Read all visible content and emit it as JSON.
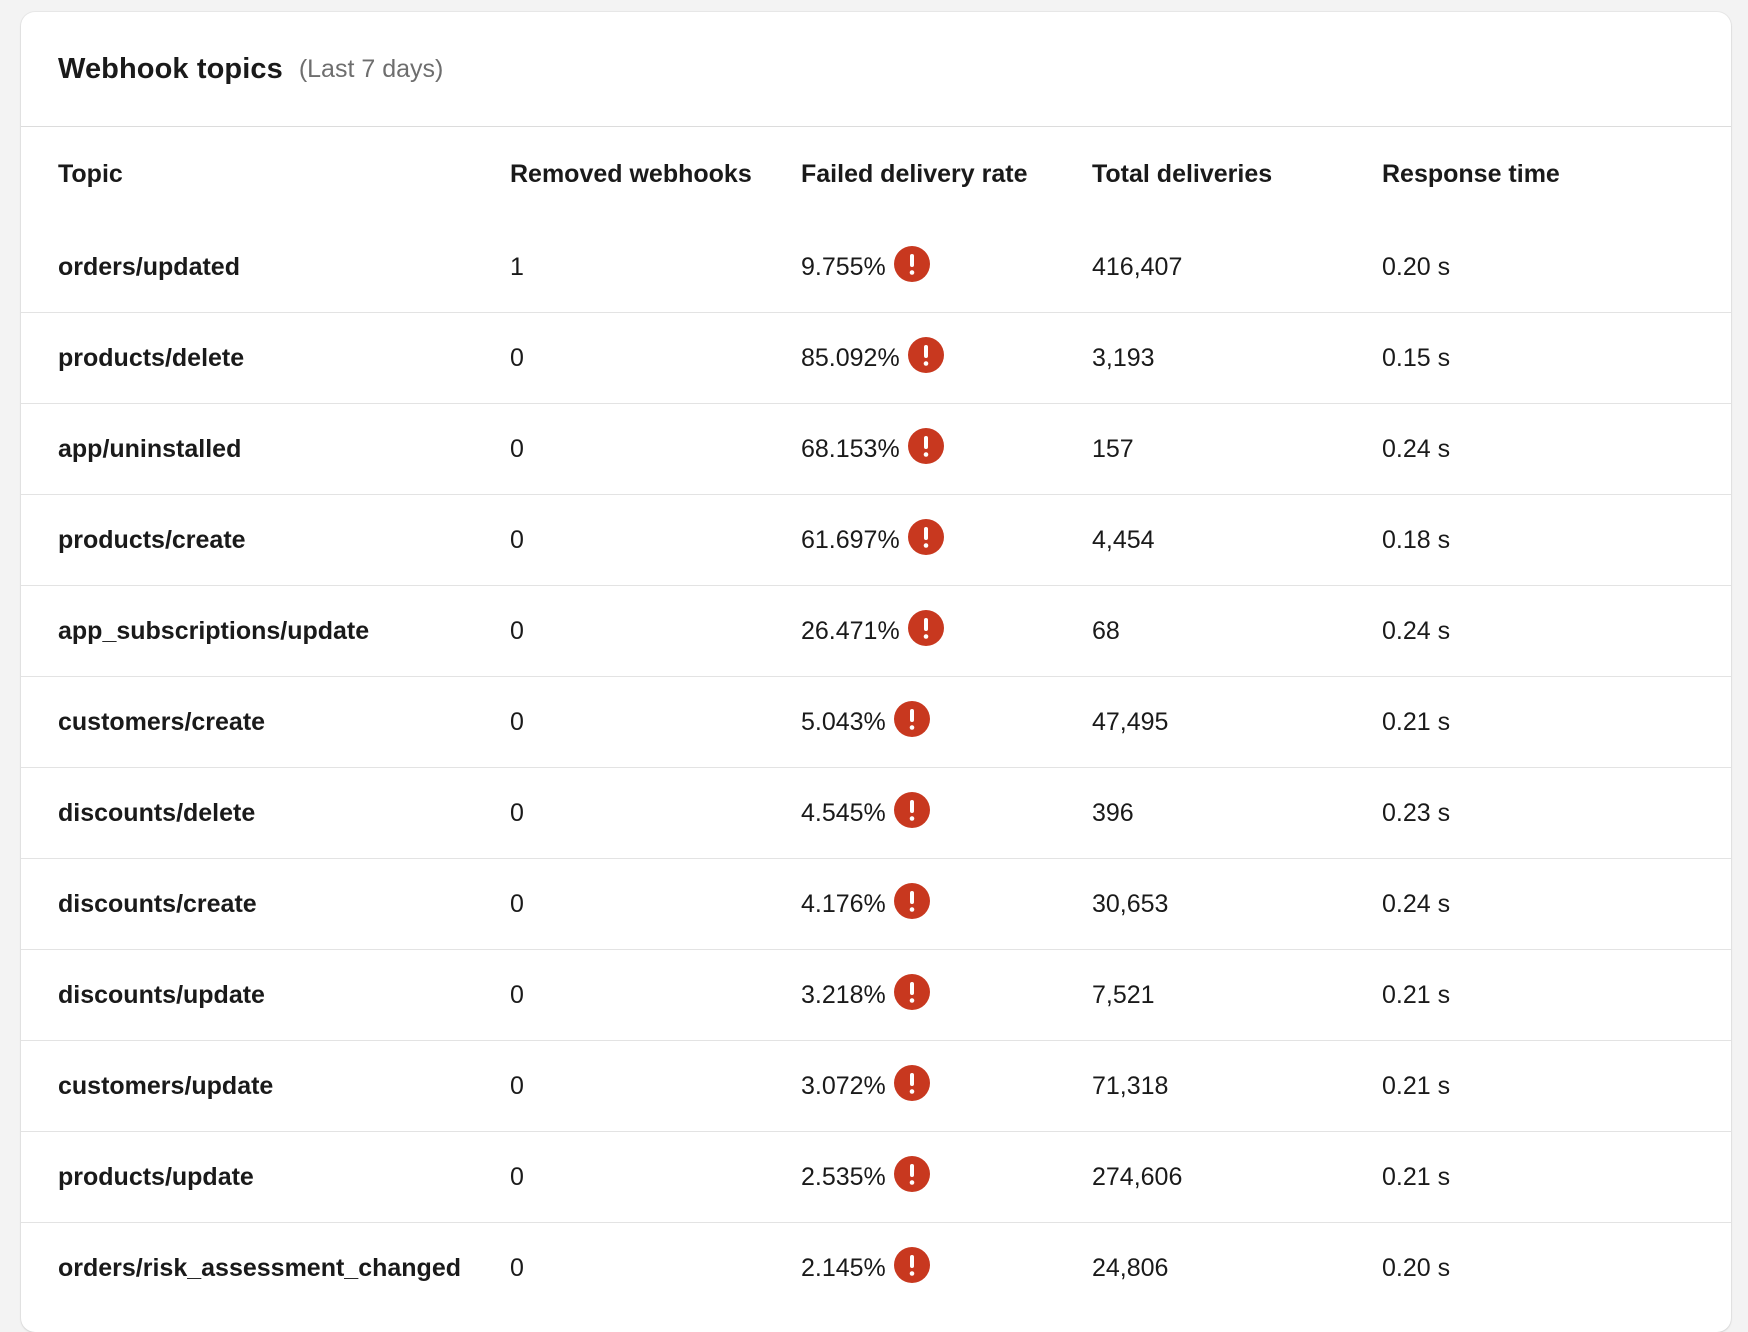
{
  "header": {
    "title": "Webhook topics",
    "subtitle": "(Last 7 days)"
  },
  "colors": {
    "alert": "#c8381f",
    "divider": "#e3e3e3"
  },
  "columns": {
    "topic": "Topic",
    "removed": "Removed webhooks",
    "rate": "Failed delivery rate",
    "total": "Total deliveries",
    "response": "Response time"
  },
  "rows": [
    {
      "topic": "orders/updated",
      "removed": "1",
      "rate": "9.755%",
      "total": "416,407",
      "response": "0.20 s",
      "icon": "alert-circle-icon"
    },
    {
      "topic": "products/delete",
      "removed": "0",
      "rate": "85.092%",
      "total": "3,193",
      "response": "0.15 s",
      "icon": "alert-circle-icon"
    },
    {
      "topic": "app/uninstalled",
      "removed": "0",
      "rate": "68.153%",
      "total": "157",
      "response": "0.24 s",
      "icon": "alert-circle-icon"
    },
    {
      "topic": "products/create",
      "removed": "0",
      "rate": "61.697%",
      "total": "4,454",
      "response": "0.18 s",
      "icon": "alert-circle-icon"
    },
    {
      "topic": "app_subscriptions/update",
      "removed": "0",
      "rate": "26.471%",
      "total": "68",
      "response": "0.24 s",
      "icon": "alert-circle-icon"
    },
    {
      "topic": "customers/create",
      "removed": "0",
      "rate": "5.043%",
      "total": "47,495",
      "response": "0.21 s",
      "icon": "alert-circle-icon"
    },
    {
      "topic": "discounts/delete",
      "removed": "0",
      "rate": "4.545%",
      "total": "396",
      "response": "0.23 s",
      "icon": "alert-circle-icon"
    },
    {
      "topic": "discounts/create",
      "removed": "0",
      "rate": "4.176%",
      "total": "30,653",
      "response": "0.24 s",
      "icon": "alert-circle-icon"
    },
    {
      "topic": "discounts/update",
      "removed": "0",
      "rate": "3.218%",
      "total": "7,521",
      "response": "0.21 s",
      "icon": "alert-circle-icon"
    },
    {
      "topic": "customers/update",
      "removed": "0",
      "rate": "3.072%",
      "total": "71,318",
      "response": "0.21 s",
      "icon": "alert-circle-icon"
    },
    {
      "topic": "products/update",
      "removed": "0",
      "rate": "2.535%",
      "total": "274,606",
      "response": "0.21 s",
      "icon": "alert-circle-icon"
    },
    {
      "topic": "orders/risk_assessment_changed",
      "removed": "0",
      "rate": "2.145%",
      "total": "24,806",
      "response": "0.20 s",
      "icon": "alert-circle-icon"
    }
  ]
}
